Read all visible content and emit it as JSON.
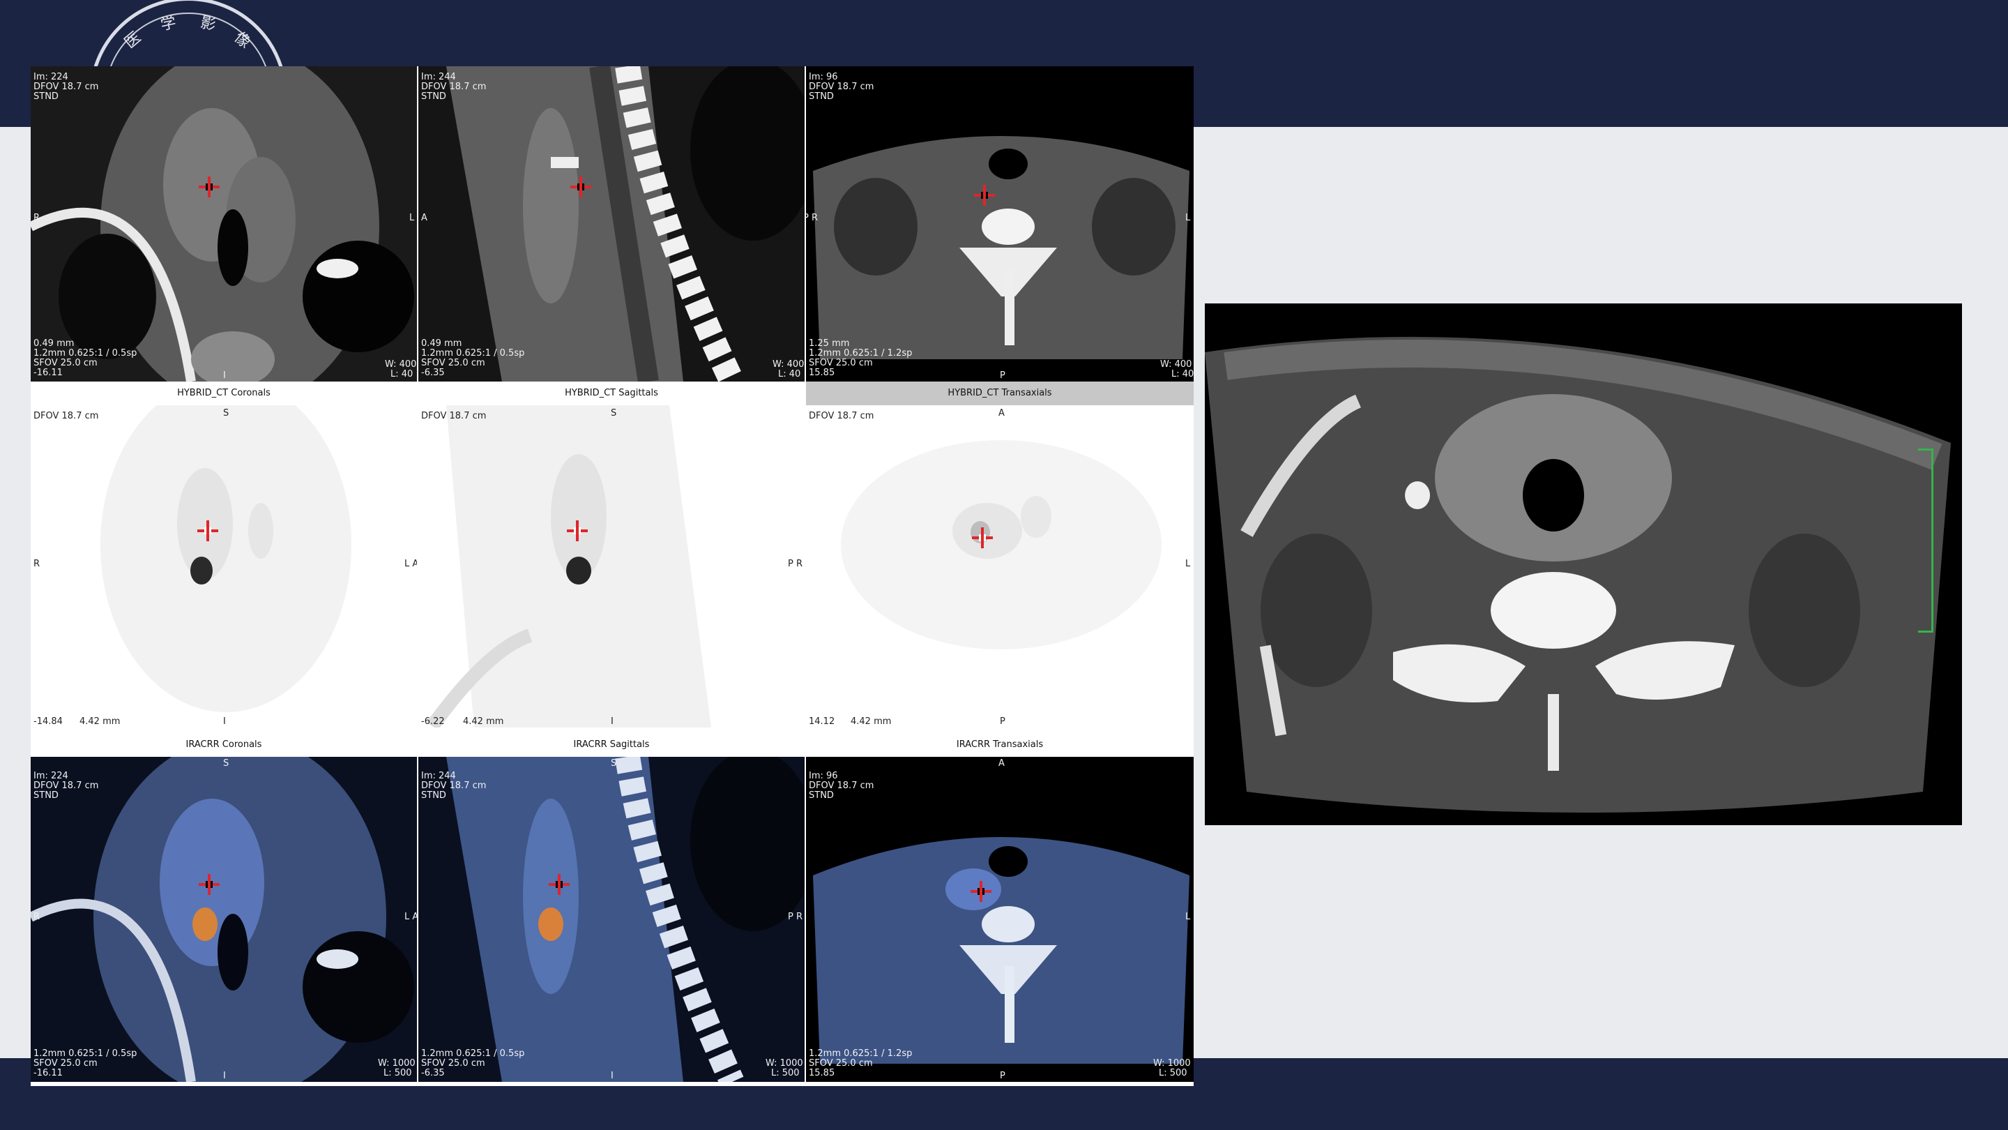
{
  "logo": {
    "chars": [
      "医",
      "学",
      "影",
      "像"
    ]
  },
  "top_row": [
    {
      "im": "Im: 224",
      "dfov": "DFOV 18.7 cm",
      "stnd": "STND",
      "left_marker": "R",
      "right_marker": "L",
      "thickness": "0.49 mm",
      "recon": "1.2mm 0.625:1 / 0.5sp",
      "sfov": "SFOV 25.0 cm",
      "pos": "-16.11",
      "bottom_marker": "I",
      "window_w": "W: 400",
      "window_l": "L: 40"
    },
    {
      "im": "Im: 244",
      "dfov": "DFOV 18.7 cm",
      "stnd": "STND",
      "left_marker": "A",
      "right_marker": "",
      "thickness": "0.49 mm",
      "recon": "1.2mm 0.625:1 / 0.5sp",
      "sfov": "SFOV 25.0 cm",
      "pos": "-6.35",
      "bottom_marker": "",
      "window_w": "",
      "window_l": ""
    },
    {
      "im": "Im: 96",
      "dfov": "DFOV 18.7 cm",
      "stnd": "STND",
      "left_marker": "P R",
      "right_marker": "L",
      "thickness": "1.25 mm",
      "recon": "1.2mm 0.625:1 / 1.2sp",
      "sfov": "SFOV 25.0 cm",
      "pos": "15.85",
      "bottom_marker": "P",
      "window_w": "W: 400",
      "window_l": "L: 40"
    }
  ],
  "top_row_extras": {
    "w2": "W: 400",
    "l2": "L: 40"
  },
  "middle_row": [
    {
      "header": "HYBRID_CT Coronals",
      "top_marker": "S",
      "dfov": "DFOV 18.7 cm",
      "left_marker": "R",
      "right_marker": "L A",
      "pos": "-14.84",
      "slice": "4.42 mm",
      "bottom_marker": "I",
      "active": false
    },
    {
      "header": "HYBRID_CT Sagittals",
      "top_marker": "S",
      "dfov": "DFOV 18.7 cm",
      "left_marker": "",
      "right_marker": "P R",
      "pos": "-6.22",
      "slice": "4.42 mm",
      "bottom_marker": "I",
      "active": false
    },
    {
      "header": "HYBRID_CT Transaxials",
      "top_marker": "A",
      "dfov": "DFOV 18.7 cm",
      "left_marker": "",
      "right_marker": "L",
      "pos": "14.12",
      "slice": "4.42 mm",
      "bottom_marker": "P",
      "active": true
    }
  ],
  "bottom_row": [
    {
      "header": "IRACRR Coronals",
      "top_marker": "S",
      "im": "Im: 224",
      "dfov": "DFOV 18.7 cm",
      "stnd": "STND",
      "left_marker": "R",
      "right_marker": "L A",
      "recon": "1.2mm 0.625:1 / 0.5sp",
      "sfov": "SFOV 25.0 cm",
      "pos": "-16.11",
      "bottom_marker": "I",
      "window_w": "W: 1000",
      "window_l": "L: 500"
    },
    {
      "header": "IRACRR Sagittals",
      "top_marker": "S",
      "im": "Im: 244",
      "dfov": "DFOV 18.7 cm",
      "stnd": "STND",
      "left_marker": "",
      "right_marker": "P R",
      "recon": "1.2mm 0.625:1 / 0.5sp",
      "sfov": "SFOV 25.0 cm",
      "pos": "-6.35",
      "bottom_marker": "I",
      "window_w": "W: 1000",
      "window_l": "L: 500"
    },
    {
      "header": "IRACRR Transaxials",
      "top_marker": "A",
      "im": "Im: 96",
      "dfov": "DFOV 18.7 cm",
      "stnd": "STND",
      "left_marker": "",
      "right_marker": "L",
      "recon": "1.2mm 0.625:1 / 1.2sp",
      "sfov": "SFOV 25.0 cm",
      "pos": "15.85",
      "bottom_marker": "P",
      "window_w": "W: 1000",
      "window_l": "L: 500"
    }
  ]
}
